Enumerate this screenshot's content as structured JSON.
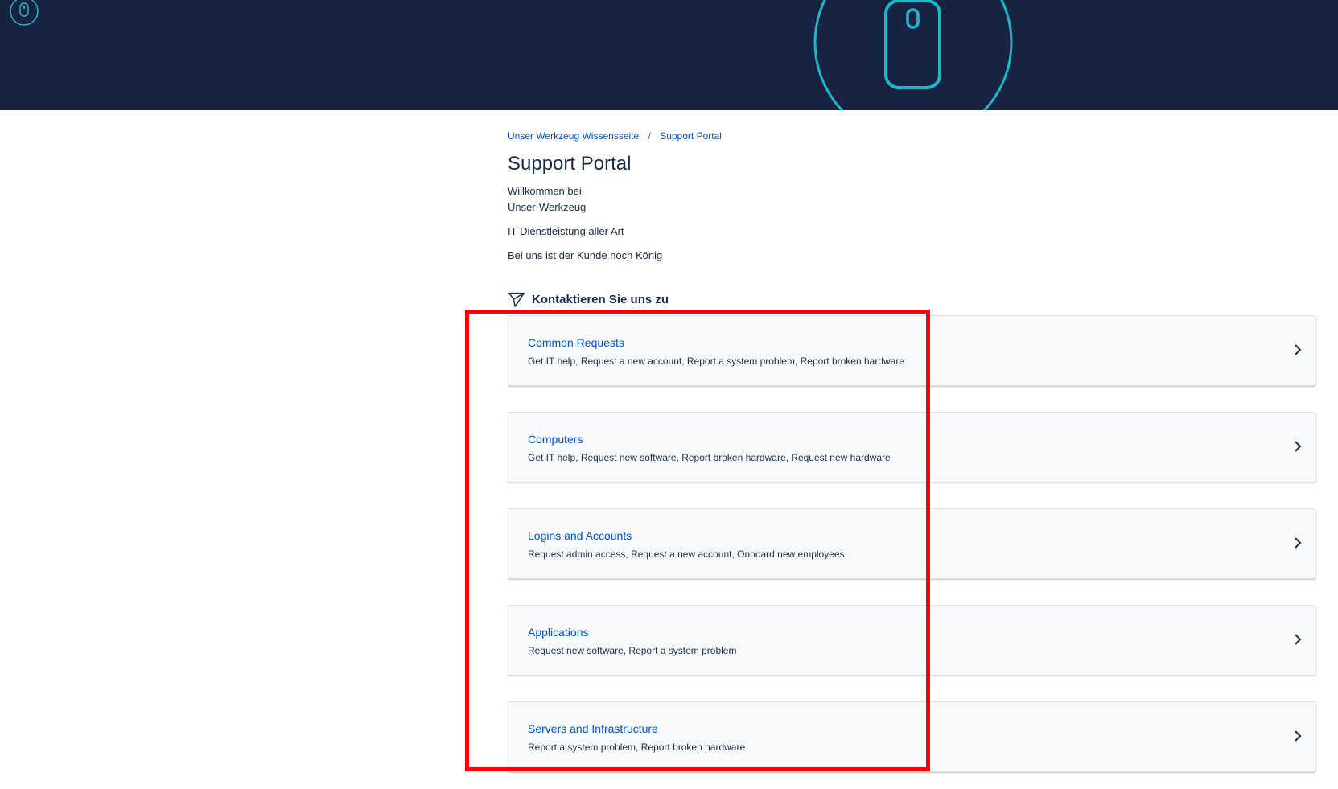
{
  "breadcrumb": {
    "home": "Unser Werkzeug Wissensseite",
    "separator": "/",
    "current": "Support Portal"
  },
  "title": "Support Portal",
  "welcome": {
    "line1": "Willkommen bei",
    "line2": "Unser-Werkzeug"
  },
  "tagline1": "IT-Dienstleistung aller Art",
  "tagline2": "Bei uns ist der Kunde noch König",
  "section": {
    "heading": "Kontaktieren Sie uns zu"
  },
  "groups": [
    {
      "title": "Common Requests",
      "desc": "Get IT help, Request a new account, Report a system problem, Report broken hardware"
    },
    {
      "title": "Computers",
      "desc": "Get IT help, Request new software, Report broken hardware, Request new hardware"
    },
    {
      "title": "Logins and Accounts",
      "desc": "Request admin access, Request a new account, Onboard new employees"
    },
    {
      "title": "Applications",
      "desc": "Request new software, Report a system problem"
    },
    {
      "title": "Servers and Infrastructure",
      "desc": "Report a system problem, Report broken hardware"
    }
  ],
  "icons": {
    "logo": "mouse-icon",
    "banner_art": "mouse-icon",
    "section": "paper-plane-icon",
    "chevron": "chevron-right-icon"
  },
  "colors": {
    "banner": "#172341",
    "accent_cyan": "#1cb8c9",
    "link": "#0052cc",
    "highlight": "#ff0000"
  }
}
